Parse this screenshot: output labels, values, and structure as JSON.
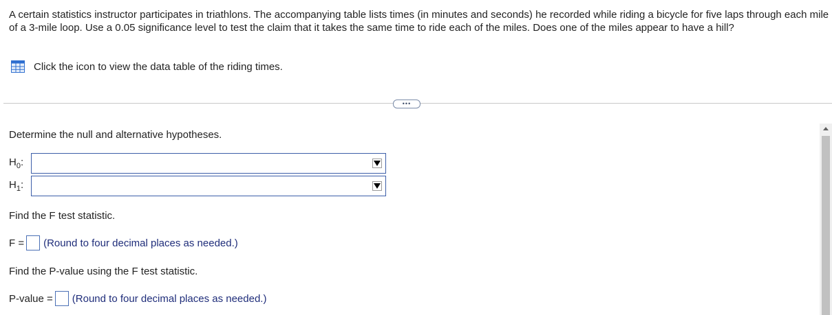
{
  "question": {
    "text": "A certain statistics instructor participates in triathlons. The accompanying table lists times (in minutes and seconds) he recorded while riding a bicycle for five laps through each mile of a 3-mile loop. Use a 0.05 significance level to test the claim that it takes the same time to ride each of the miles. Does one of the miles appear to have a hill?"
  },
  "data_link": {
    "icon": "table-grid-icon",
    "label": "Click the icon to view the data table of the riding times."
  },
  "more_button": {
    "label": "•••"
  },
  "hypotheses": {
    "prompt": "Determine the null and alternative hypotheses.",
    "h0_label": "H",
    "h0_sub": "0",
    "h1_label": "H",
    "h1_sub": "1",
    "colon": ":",
    "h0_value": "",
    "h1_value": ""
  },
  "f_stat": {
    "prompt": "Find the F test statistic.",
    "label": "F =",
    "value": "",
    "hint": "(Round to four decimal places as needed.)"
  },
  "p_value": {
    "prompt": "Find the P-value using the F test statistic.",
    "label": "P-value =",
    "value": "",
    "hint": "(Round to four decimal places as needed.)"
  },
  "colors": {
    "accent_border": "#3b5da8",
    "hint_text": "#1f2d7a",
    "icon_blue": "#2f6fd0"
  }
}
